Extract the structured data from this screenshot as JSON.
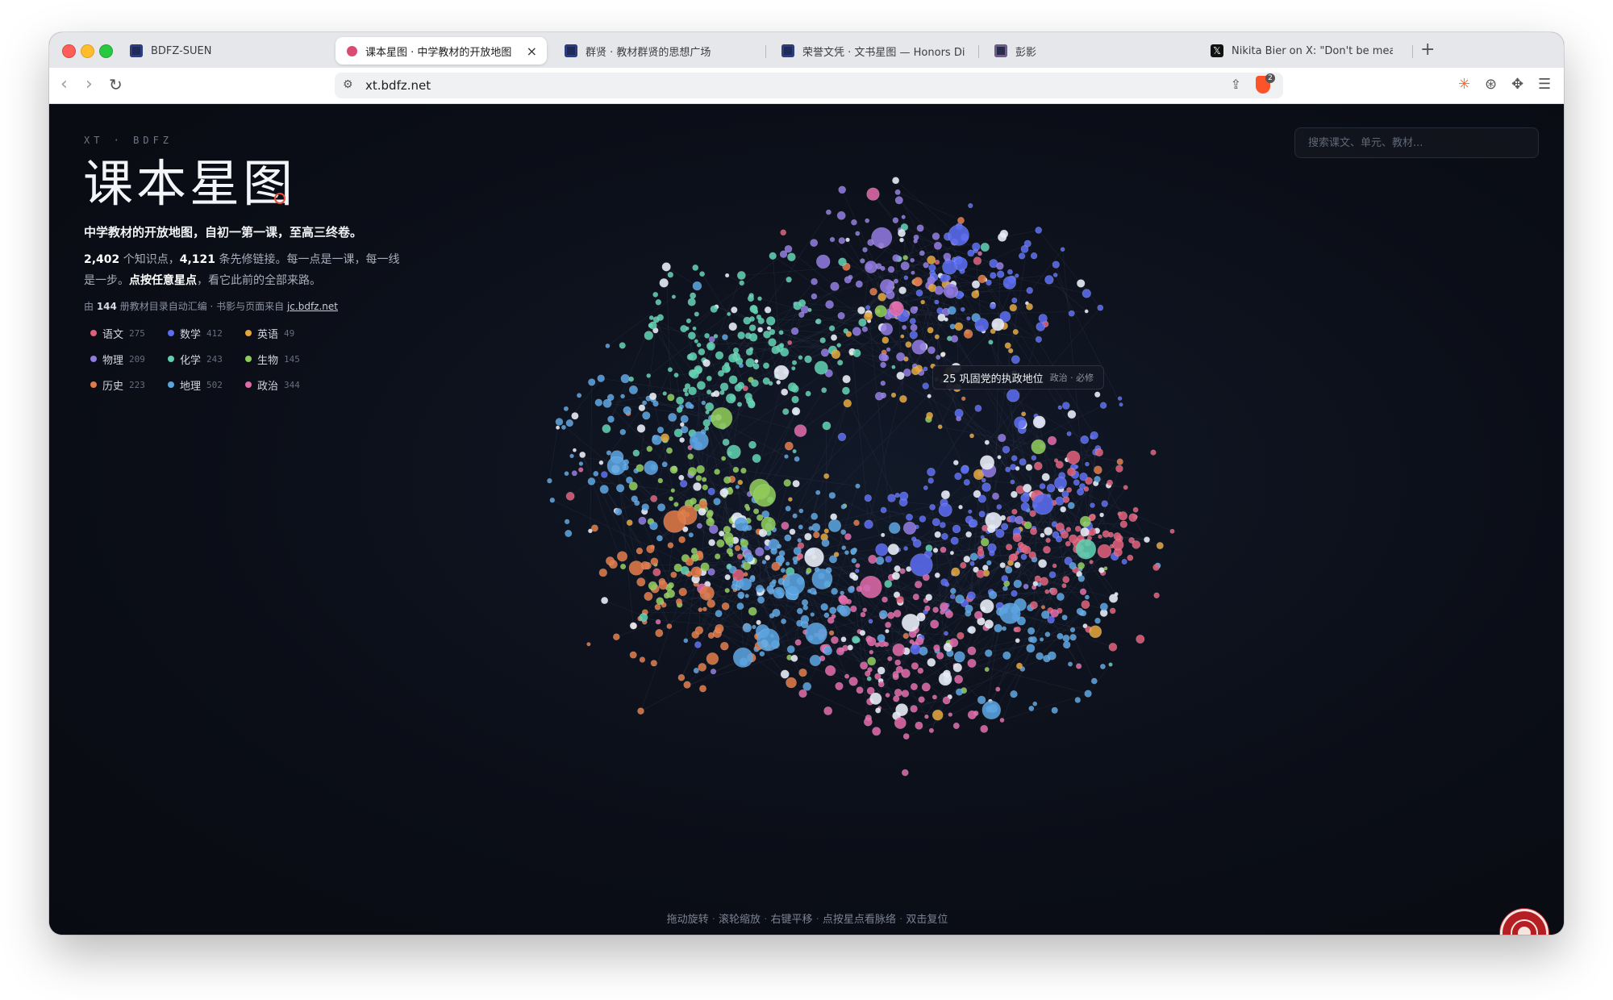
{
  "browser": {
    "tabs": [
      {
        "label": "BDFZ-SUEN",
        "favicon": "bdfz-icon",
        "active": false
      },
      {
        "label": "课本星图 · 中学教材的开放地图",
        "favicon": "pink-dot-icon",
        "active": true
      },
      {
        "label": "群贤 · 教材群贤的思想广场",
        "favicon": "bdfz-icon",
        "active": false
      },
      {
        "label": "荣誉文凭 · 文书星图 — Honors Diplo",
        "favicon": "bdfz-icon",
        "active": false
      },
      {
        "label": "彭影",
        "favicon": "book-icon",
        "active": false
      },
      {
        "label": "Nikita Bier on X: \"Don't be mean o",
        "favicon": "x-icon",
        "active": false
      }
    ],
    "close_glyph": "×",
    "newtab_glyph": "+",
    "url": "xt.bdfz.net",
    "shield_count": "2"
  },
  "page": {
    "kicker": "XT · BDFZ",
    "title": "课本星图",
    "tagline": "中学教材的开放地图，自初一第一课，至高三终卷。",
    "stats": {
      "nodes": "2,402",
      "nodes_suffix": " 个知识点，",
      "links": "4,121",
      "links_suffix": " 条先修链接。每一点是一课，每一线是一步。",
      "emph": "点按任意星点",
      "tail": "，看它此前的全部来路。"
    },
    "source": {
      "prefix": "由 ",
      "count": "144",
      "middle": " 册教材目录自动汇编 · 书影与页面来自 ",
      "link": "jc.bdfz.net"
    },
    "search_placeholder": "搜索课文、单元、教材...",
    "tooltip": {
      "title": "25 巩固党的执政地位",
      "meta": "政治 · 必修"
    },
    "hints": [
      "拖动旋转",
      "滚轮缩放",
      "右键平移",
      "点按星点看脉络",
      "双击复位"
    ],
    "hint_sep": "·"
  },
  "legend": [
    {
      "name": "语文",
      "count": "275",
      "color": "#e0607a"
    },
    {
      "name": "数学",
      "count": "412",
      "color": "#5b6cf0"
    },
    {
      "name": "英语",
      "count": "49",
      "color": "#e3a53c"
    },
    {
      "name": "物理",
      "count": "209",
      "color": "#8f7ae0"
    },
    {
      "name": "化学",
      "count": "243",
      "color": "#5fd0b0"
    },
    {
      "name": "生物",
      "count": "145",
      "color": "#8fcc5a"
    },
    {
      "name": "历史",
      "count": "223",
      "color": "#e07a48"
    },
    {
      "name": "地理",
      "count": "502",
      "color": "#5aa4e0"
    },
    {
      "name": "政治",
      "count": "344",
      "color": "#e06aa8"
    }
  ]
}
